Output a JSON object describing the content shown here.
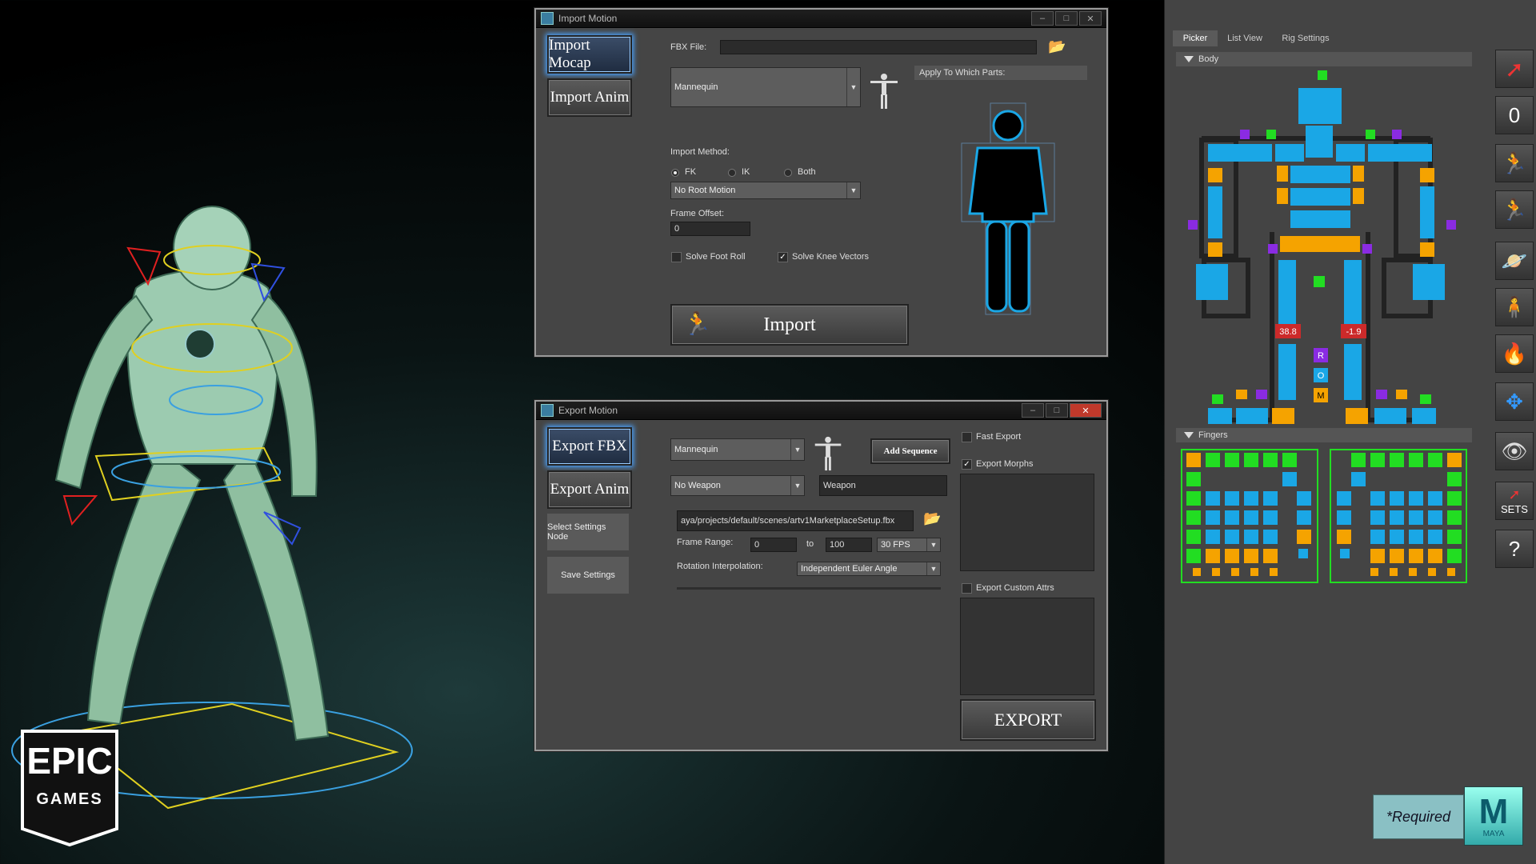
{
  "import_window": {
    "title": "Import Motion",
    "tabs": {
      "mocap": "Import Mocap",
      "anim": "Import Anim"
    },
    "fbx_label": "FBX File:",
    "fbx_value": "",
    "character": "Mannequin",
    "apply_parts_label": "Apply To Which Parts:",
    "method_label": "Import Method:",
    "methods": [
      "FK",
      "IK",
      "Both"
    ],
    "root_motion": "No Root Motion",
    "frame_offset_label": "Frame Offset:",
    "frame_offset": "0",
    "solve_foot_roll": "Solve Foot Roll",
    "solve_knee_vectors": "Solve Knee Vectors",
    "import_button": "Import"
  },
  "export_window": {
    "title": "Export Motion",
    "tabs": {
      "fbx": "Export FBX",
      "anim": "Export Anim"
    },
    "select_settings": "Select Settings Node",
    "save_settings": "Save Settings",
    "character": "Mannequin",
    "add_sequence": "Add Sequence",
    "weapon_dropdown": "No Weapon",
    "weapon_field": "Weapon",
    "path": "aya/projects/default/scenes/artv1MarketplaceSetup.fbx",
    "frame_range_label": "Frame Range:",
    "frame_start": "0",
    "to_label": "to",
    "frame_end": "100",
    "fps": "30 FPS",
    "rotation_label": "Rotation Interpolation:",
    "rotation_value": "Independent Euler Angle",
    "fast_export": "Fast Export",
    "export_morphs": "Export Morphs",
    "export_custom_attrs": "Export Custom Attrs",
    "export_button": "EXPORT"
  },
  "picker": {
    "tabs": [
      "Picker",
      "List View",
      "Rig Settings"
    ],
    "body_label": "Body",
    "fingers_label": "Fingers",
    "left_value": "38.8",
    "right_value": "-1.9",
    "rom": [
      "R",
      "O",
      "M"
    ],
    "tools": [
      "0",
      "SETS",
      "?"
    ]
  },
  "badges": {
    "required": "*Required",
    "maya": "MAYA",
    "maya_letter": "M",
    "epic_top": "EPIC",
    "epic_bottom": "GAMES"
  },
  "colors": {
    "cyan": "#1aa7e6",
    "orange": "#f5a300",
    "green": "#22dd22",
    "purple": "#8a2be2",
    "red": "#cc2a2a"
  }
}
